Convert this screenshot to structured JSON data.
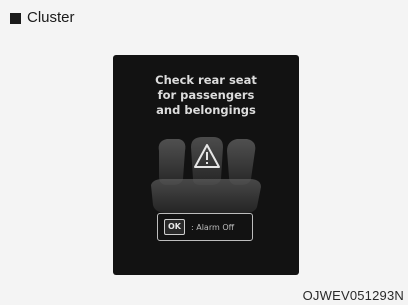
{
  "section": {
    "label": "Cluster"
  },
  "cluster_display": {
    "message_lines": [
      "Check rear seat",
      "for passengers",
      "and belongings"
    ],
    "ok_key": "OK",
    "ok_action": ": Alarm Off"
  },
  "figure_code": "OJWEV051293N",
  "colors": {
    "screen_background": "#121212",
    "text_light": "#dcdcdc",
    "page_background": "#f4f4f4"
  }
}
